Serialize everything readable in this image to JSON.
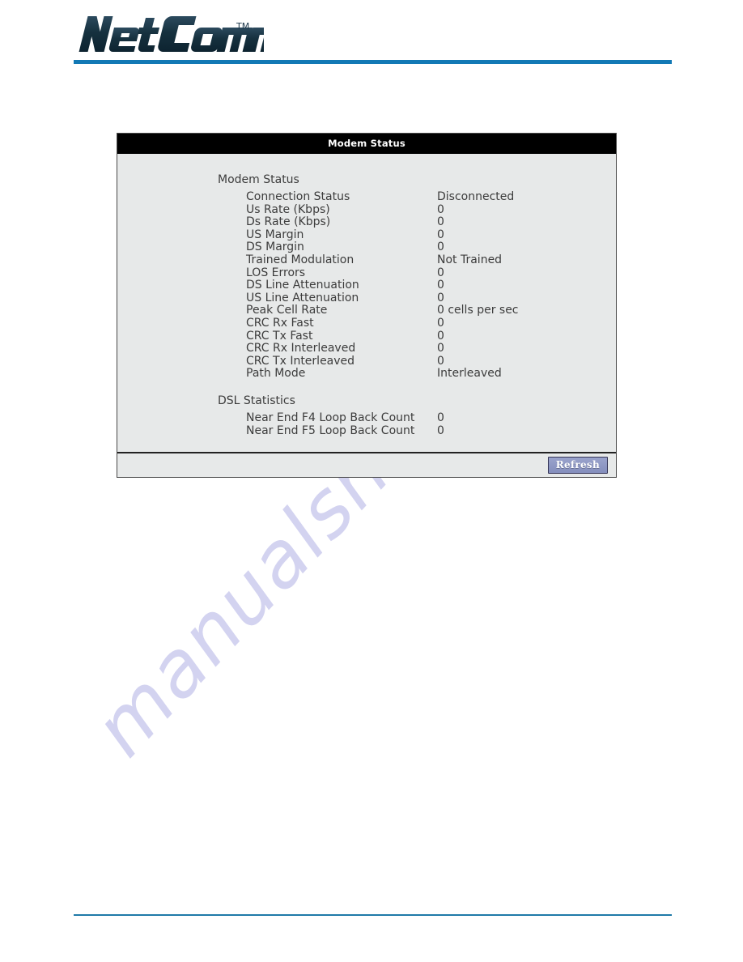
{
  "brand": {
    "name": "NetComm",
    "trademark": "TM",
    "accent_color": "#1279b5"
  },
  "panel": {
    "title": "Modem Status",
    "sections": [
      {
        "heading": "Modem Status",
        "rows": [
          {
            "label": "Connection Status",
            "value": "Disconnected"
          },
          {
            "label": "Us Rate (Kbps)",
            "value": "0"
          },
          {
            "label": "Ds Rate (Kbps)",
            "value": "0"
          },
          {
            "label": "US Margin",
            "value": "0"
          },
          {
            "label": "DS Margin",
            "value": "0"
          },
          {
            "label": "Trained Modulation",
            "value": "Not Trained"
          },
          {
            "label": "LOS Errors",
            "value": "0"
          },
          {
            "label": "DS Line Attenuation",
            "value": "0"
          },
          {
            "label": "US Line Attenuation",
            "value": "0"
          },
          {
            "label": "Peak Cell Rate",
            "value": "0 cells per sec"
          },
          {
            "label": "CRC Rx Fast",
            "value": "0"
          },
          {
            "label": "CRC Tx Fast",
            "value": "0"
          },
          {
            "label": "CRC Rx Interleaved",
            "value": "0"
          },
          {
            "label": "CRC Tx Interleaved",
            "value": "0"
          },
          {
            "label": "Path Mode",
            "value": "Interleaved"
          }
        ]
      },
      {
        "heading": "DSL Statistics",
        "rows": [
          {
            "label": "Near End F4 Loop Back Count",
            "value": "0"
          },
          {
            "label": "Near End F5 Loop Back Count",
            "value": "0"
          }
        ]
      }
    ],
    "footer": {
      "refresh_label": "Refresh",
      "refresh_color": "#8f99c6"
    }
  },
  "watermark": {
    "text": "manualshive.com",
    "color": "#ccccee"
  }
}
